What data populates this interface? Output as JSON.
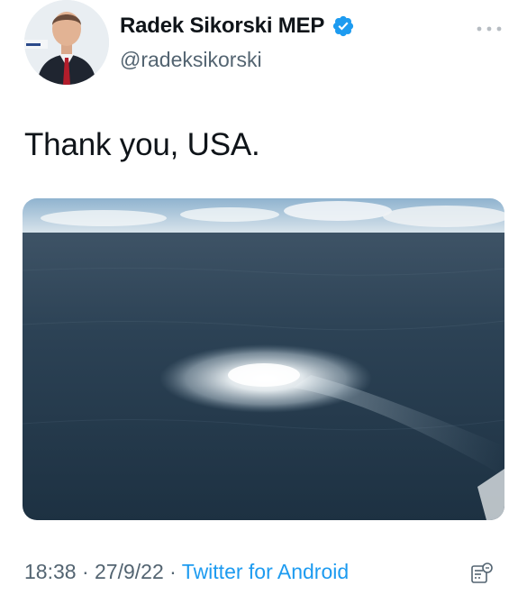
{
  "tweet": {
    "author": {
      "display_name": "Radek Sikorski MEP",
      "handle": "@radeksikorski",
      "verified": true,
      "avatar_icon": "portrait-avatar"
    },
    "text": "Thank you, USA.",
    "media": {
      "icon": "photo-sea-gas-leak"
    },
    "time": "18:38",
    "separator": " · ",
    "date": "27/9/22",
    "source": "Twitter for Android",
    "colors": {
      "link": "#1d9bf0",
      "verified": "#1d9bf0",
      "secondary_text": "#536471"
    }
  }
}
